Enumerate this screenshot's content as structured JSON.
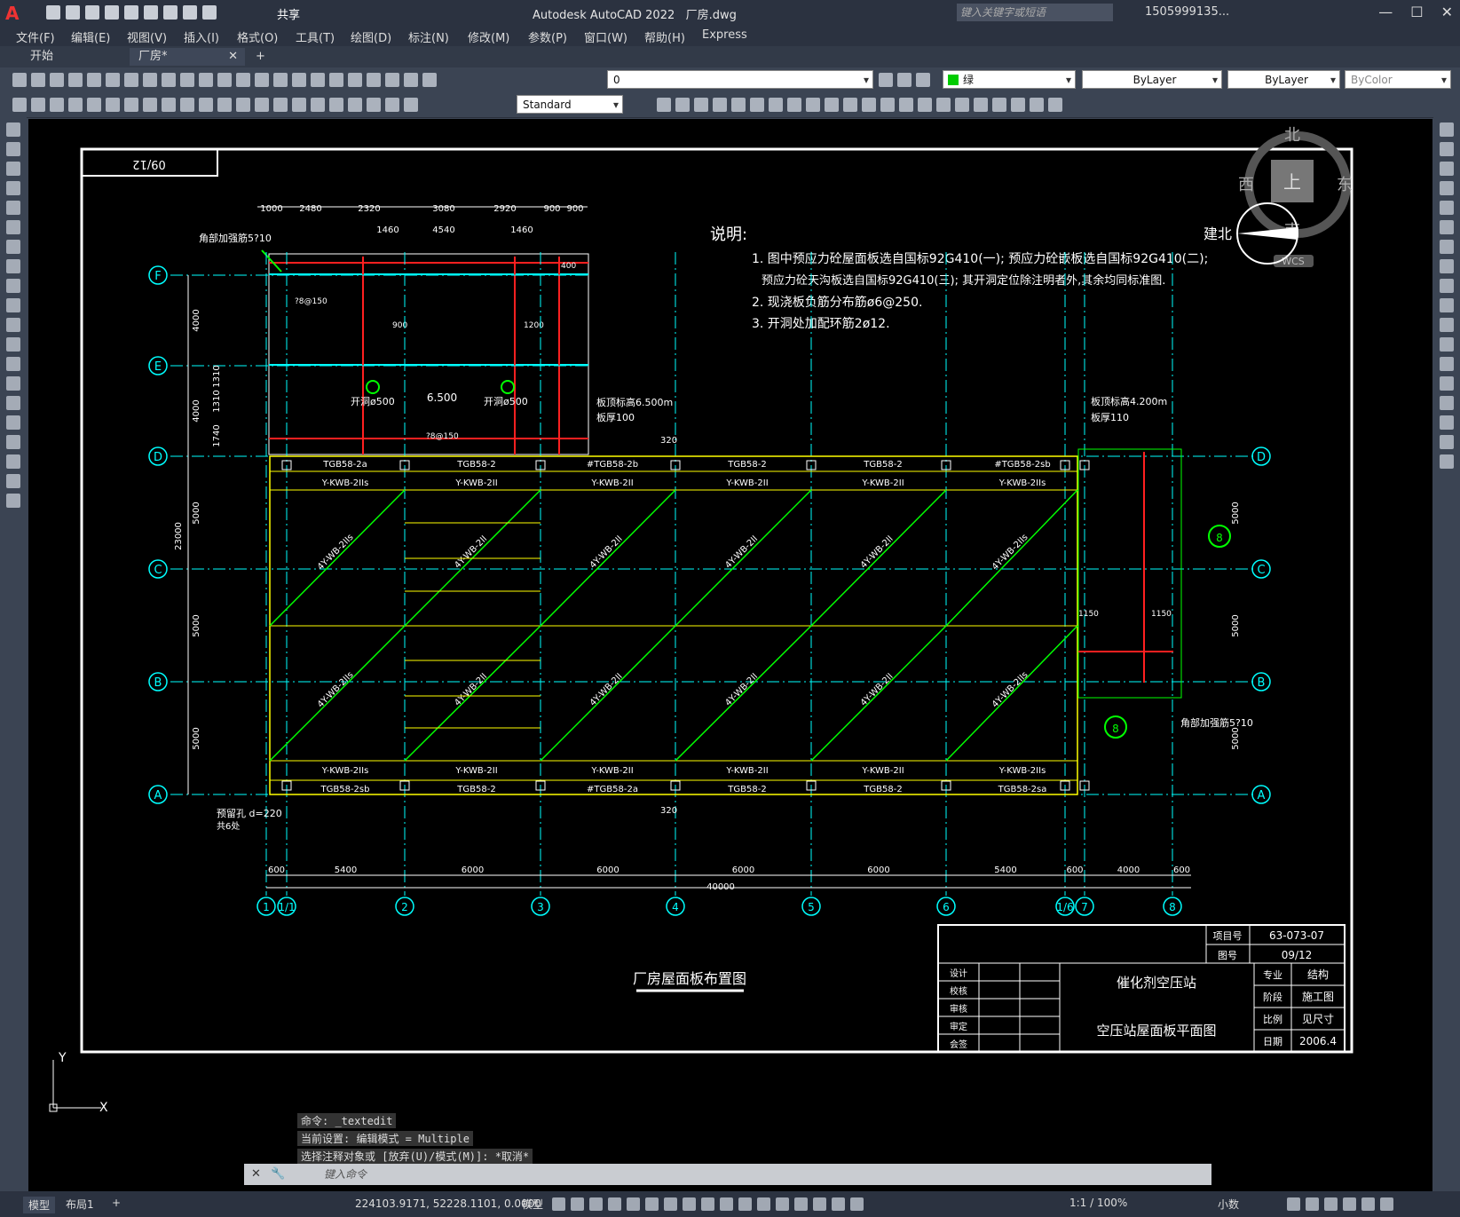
{
  "app": {
    "title": "Autodesk AutoCAD 2022",
    "file": "厂房.dwg",
    "share": "共享",
    "search_placeholder": "键入关键字或短语",
    "user": "1505999135...",
    "logo": "A"
  },
  "menu": [
    "文件(F)",
    "编辑(E)",
    "视图(V)",
    "插入(I)",
    "格式(O)",
    "工具(T)",
    "绘图(D)",
    "标注(N)",
    "修改(M)",
    "参数(P)",
    "窗口(W)",
    "帮助(H)",
    "Express"
  ],
  "tabs": [
    {
      "label": "开始"
    },
    {
      "label": "厂房*"
    }
  ],
  "toolbar": {
    "layer": "0",
    "color": "绿",
    "linetype": "ByLayer",
    "lineweight": "ByLayer",
    "plotstyle": "ByColor",
    "textstyle": "Standard"
  },
  "viewcube": {
    "north": "北",
    "south": "南",
    "east": "东",
    "west": "西",
    "top": "上",
    "compass_label": "建北",
    "wcs": "WCS"
  },
  "drawing": {
    "sheet_tag": "09/12",
    "title": "厂房屋面板布置图",
    "notes_title": "说明:",
    "notes": [
      "1. 图中预应力砼屋面板选自国标92G410(一); 预应力砼嵌板选自国标92G410(二);",
      "预应力砼天沟板选自国标92G410(三); 其开洞定位除注明者外,其余均同标准图.",
      "2. 现浇板负筋分布筋ø6@250.",
      "3. 开洞处加配环筋2ø12."
    ],
    "axes_rows": [
      "F",
      "E",
      "D",
      "C",
      "B",
      "A"
    ],
    "axes_cols": [
      "1",
      "1/1",
      "2",
      "3",
      "4",
      "5",
      "6",
      "1/6",
      "7",
      "8"
    ],
    "top_dims": [
      "1000",
      "2480",
      "2320",
      "3080",
      "2920",
      "900",
      "900"
    ],
    "top_dims2": [
      "1460",
      "4540",
      "1460"
    ],
    "bottom_dims": [
      "600",
      "5400",
      "6000",
      "6000",
      "6000",
      "6000",
      "5400",
      "600",
      "4000",
      "600"
    ],
    "total_dim": "40000",
    "left_dims": [
      "4000",
      "4000",
      "1740",
      "1310",
      "1310",
      "5000",
      "5000",
      "5000",
      "23000"
    ],
    "right_dims": [
      "5000",
      "5000",
      "5000"
    ],
    "beam_top1": [
      "TGB58-2a",
      "TGB58-2",
      "#TGB58-2b",
      "TGB58-2",
      "TGB58-2",
      "#TGB58-2sb"
    ],
    "beam_top2": [
      "Y-KWB-2IIs",
      "Y-KWB-2II",
      "Y-KWB-2II",
      "Y-KWB-2II",
      "Y-KWB-2II",
      "Y-KWB-2IIs"
    ],
    "beam_bot1": [
      "Y-KWB-2IIs",
      "Y-KWB-2II",
      "Y-KWB-2II",
      "Y-KWB-2II",
      "Y-KWB-2II",
      "Y-KWB-2IIs"
    ],
    "beam_bot2": [
      "TGB58-2sb",
      "TGB58-2",
      "#TGB58-2a",
      "TGB58-2",
      "TGB58-2",
      "TGB58-2sa"
    ],
    "panel_labels_upper": [
      "4Y-WB-2IIs",
      "4Y-WB-2II",
      "4Y-WB-2II",
      "4Y-WB-2II",
      "4Y-WB-2II",
      "4Y-WB-2IIs"
    ],
    "panel_labels_lower": [
      "4Y-WB-2IIs",
      "4Y-WB-2II",
      "4Y-WB-2II",
      "4Y-WB-2II",
      "4Y-WB-2II",
      "4Y-WB-2IIs"
    ],
    "annotations": {
      "elev_6500": "6.500",
      "roof_elev_a": "板顶标高6.500m",
      "slab_a": "板厚100",
      "roof_elev_b": "板顶标高4.200m",
      "slab_b": "板厚110",
      "hole_a": "开洞ø500",
      "hole_b": "开洞ø500",
      "corner_a": "角部加强筋5?10",
      "corner_b": "角部加强筋5?10",
      "rebar": "?8@150",
      "dim_320": "320",
      "dim_1150": "1150",
      "bottom_left_a": "预留孔 d=220",
      "bottom_left_b": "共6处",
      "section_mark": "8",
      "dim_400": "400",
      "dim_900": "900",
      "dim_1200": "1200"
    },
    "titleblock": {
      "project_no_label": "项目号",
      "project_no": "63-073-07",
      "drawing_no_label": "图号",
      "drawing_no": "09/12",
      "left_labels": [
        "设计",
        "校核",
        "审核",
        "审定",
        "会签"
      ],
      "project_name": "催化剂空压站",
      "drawing_name": "空压站屋面板平面图",
      "right_labels": [
        "专业",
        "阶段",
        "比例",
        "日期"
      ],
      "right_values": [
        "结构",
        "施工图",
        "见尺寸",
        "2006.4"
      ]
    }
  },
  "command": {
    "history": [
      "命令: _textedit",
      "当前设置: 编辑模式 = Multiple",
      "选择注释对象或 [放弃(U)/模式(M)]: *取消*"
    ],
    "input_placeholder": "键入命令"
  },
  "ucs": {
    "x": "X",
    "y": "Y"
  },
  "status": {
    "tabs": [
      "模型",
      "布局1"
    ],
    "coords": "224103.9171, 52228.1101, 0.0000",
    "space": "模型",
    "scale": "1:1 / 100%",
    "units": "小数"
  },
  "colors": {
    "canvas_bg": "#000000",
    "axis": "#00ffff",
    "panel": "#ffff00",
    "diagonal": "#00ff00",
    "rebar": "#ff2020",
    "frame": "#ffffff"
  }
}
